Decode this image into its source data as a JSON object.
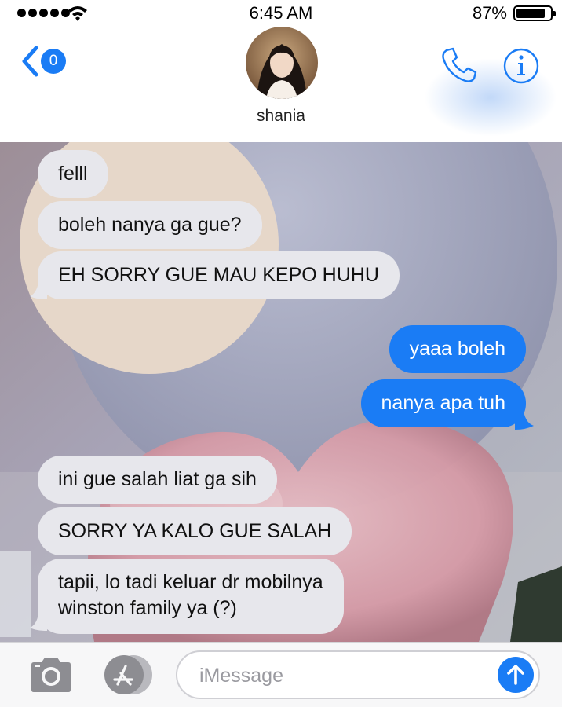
{
  "status_bar": {
    "time": "6:45 AM",
    "battery_percent": "87%",
    "signal_bars": 5,
    "battery_level": 0.87,
    "icons": [
      "signal-dots-icon",
      "wifi-icon",
      "battery-icon"
    ]
  },
  "header": {
    "back_badge_count": "0",
    "contact_name": "shania",
    "icons": [
      "chevron-left-icon",
      "phone-icon",
      "info-icon"
    ]
  },
  "messages": [
    {
      "direction": "incoming",
      "text": "felll"
    },
    {
      "direction": "incoming",
      "text": "boleh nanya ga gue?"
    },
    {
      "direction": "incoming",
      "text": "EH SORRY GUE MAU KEPO HUHU"
    },
    {
      "direction": "outgoing",
      "text": "yaaa boleh"
    },
    {
      "direction": "outgoing",
      "text": "nanya apa tuh"
    },
    {
      "direction": "incoming",
      "text": "ini gue salah liat ga sih"
    },
    {
      "direction": "incoming",
      "text": "SORRY YA KALO GUE SALAH"
    },
    {
      "direction": "incoming",
      "lines": [
        "tapii, lo tadi keluar dr mobilnya",
        "winston family ya (?)"
      ]
    }
  ],
  "input_bar": {
    "placeholder": "iMessage",
    "value": "",
    "icons": [
      "camera-icon",
      "app-store-icon",
      "send-arrow-icon"
    ]
  },
  "colors": {
    "accent": "#1a7cf5",
    "incoming_bubble": "#e7e7ec",
    "outgoing_bubble": "#1a7cf5"
  }
}
